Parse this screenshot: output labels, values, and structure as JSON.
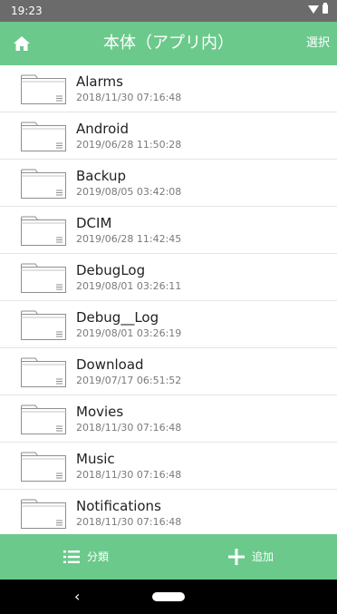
{
  "status_bar": {
    "time": "19:23"
  },
  "app_bar": {
    "title": "本体（アプリ内）",
    "select_label": "選択"
  },
  "files": [
    {
      "name": "Alarms",
      "date": "2018/11/30 07:16:48"
    },
    {
      "name": "Android",
      "date": "2019/06/28 11:50:28"
    },
    {
      "name": "Backup",
      "date": "2019/08/05 03:42:08"
    },
    {
      "name": "DCIM",
      "date": "2019/06/28 11:42:45"
    },
    {
      "name": "DebugLog",
      "date": "2019/08/01 03:26:11"
    },
    {
      "name": "Debug__Log",
      "date": "2019/08/01 03:26:19"
    },
    {
      "name": "Download",
      "date": "2019/07/17 06:51:52"
    },
    {
      "name": "Movies",
      "date": "2018/11/30 07:16:48"
    },
    {
      "name": "Music",
      "date": "2018/11/30 07:16:48"
    },
    {
      "name": "Notifications",
      "date": "2018/11/30 07:16:48"
    }
  ],
  "bottom_bar": {
    "categories_label": "分類",
    "add_label": "追加"
  },
  "nav_bar": {
    "back_glyph": "‹"
  },
  "colors": {
    "accent": "#6cc98c",
    "status_bar": "#6b6b6b"
  }
}
